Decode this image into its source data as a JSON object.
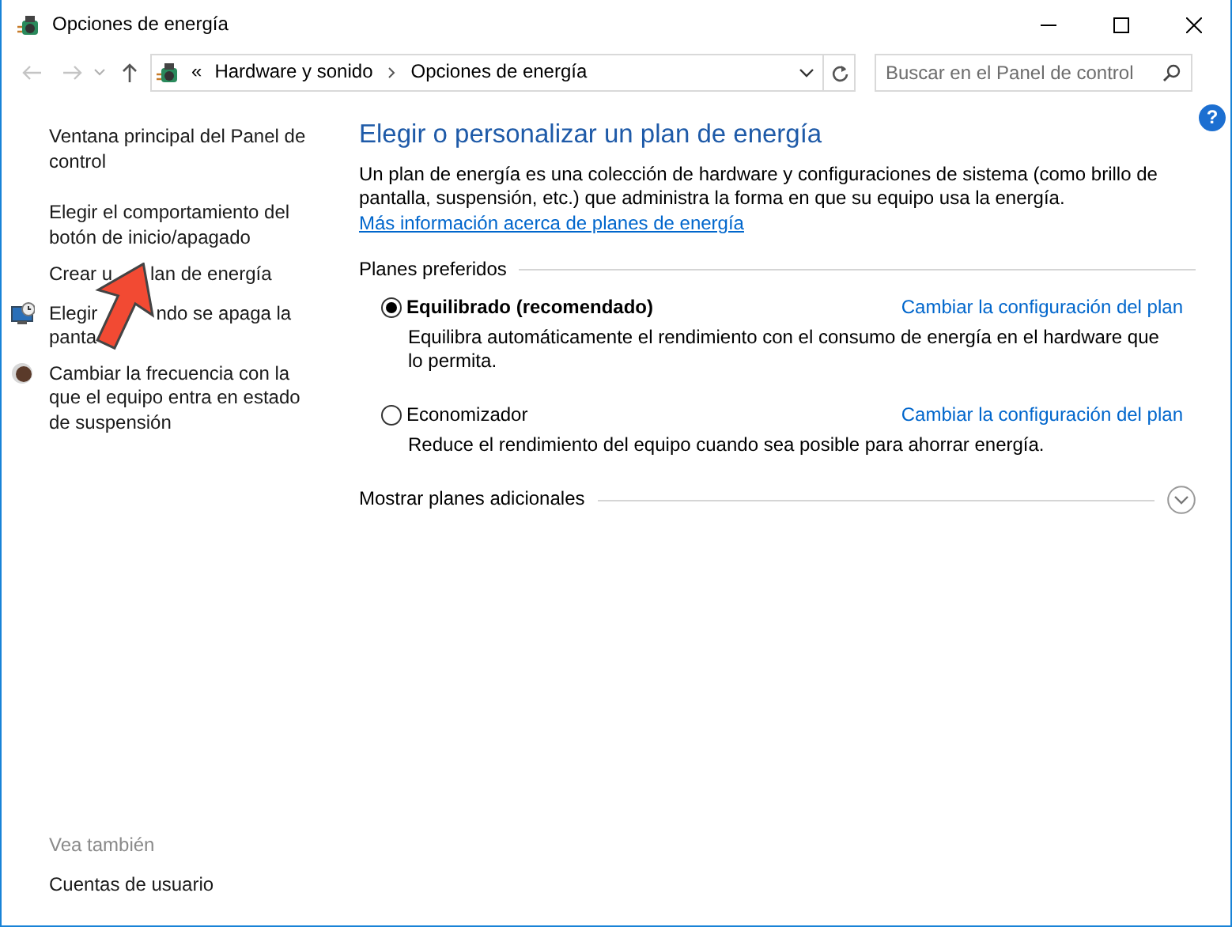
{
  "window": {
    "title": "Opciones de energía"
  },
  "address_bar": {
    "overflow": "«",
    "path": [
      "Hardware y sonido",
      "Opciones de energía"
    ]
  },
  "search": {
    "placeholder": "Buscar en el Panel de control"
  },
  "help": "?",
  "sidebar": {
    "items": [
      {
        "kind": "plain",
        "text": "Ventana principal del Panel de control"
      },
      {
        "kind": "plain",
        "text": "Elegir el comportamiento del botón de inicio/apagado"
      },
      {
        "kind": "plain",
        "lines": [
          [
            "Crear u",
            "lan de energía"
          ]
        ]
      },
      {
        "kind": "display",
        "lines": [
          [
            "Elegir",
            "ndo se apaga la"
          ],
          [
            "panta"
          ]
        ]
      },
      {
        "kind": "sleep",
        "text": "Cambiar la frecuencia con la que el equipo entra en estado de suspensión"
      }
    ],
    "see_also_heading": "Vea también",
    "see_also": [
      "Cuentas de usuario"
    ]
  },
  "main": {
    "title": "Elegir o personalizar un plan de energía",
    "description": "Un plan de energía es una colección de hardware y configuraciones de sistema (como brillo de pantalla, suspensión, etc.) que administra la forma en que su equipo usa la energía.",
    "link": "Más información acerca de planes de energía",
    "group_label": "Planes preferidos",
    "plans": [
      {
        "name": "Equilibrado (recomendado)",
        "selected": true,
        "link": "Cambiar la configuración del plan",
        "description": "Equilibra automáticamente el rendimiento con el consumo de energía en el hardware que lo permita."
      },
      {
        "name": "Economizador",
        "selected": false,
        "link": "Cambiar la configuración del plan",
        "description": "Reduce el rendimiento del equipo cuando sea posible para ahorrar energía."
      }
    ],
    "more": {
      "label": "Mostrar planes adicionales",
      "expanded": false
    }
  },
  "annotation": {
    "kind": "arrow"
  }
}
